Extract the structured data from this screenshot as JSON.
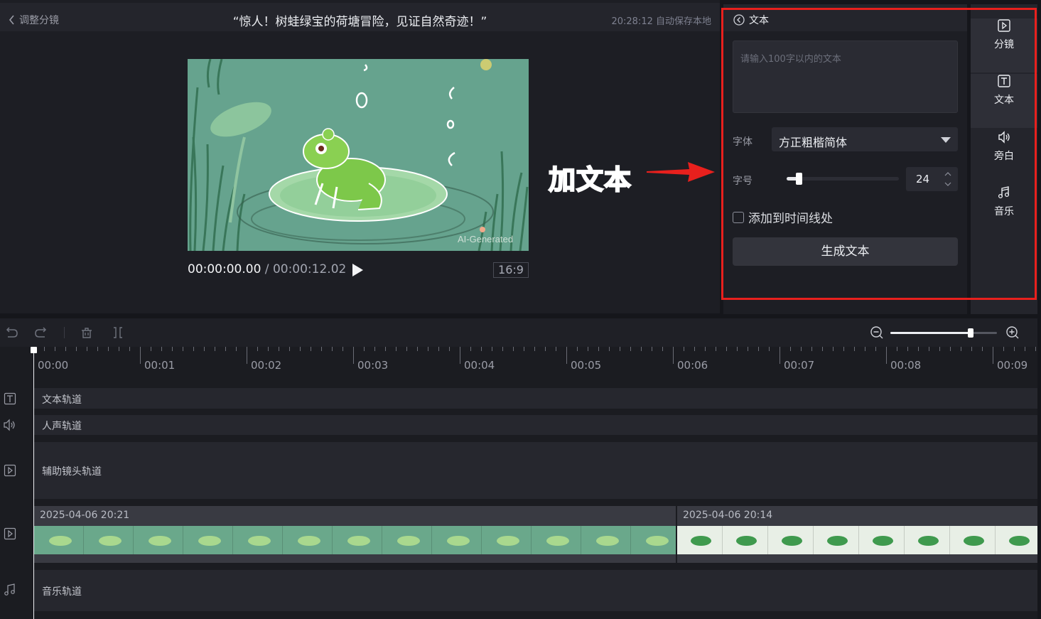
{
  "header": {
    "back_label": "调整分镜",
    "title": "“惊人！树蛙绿宝的荷塘冒险，见证自然奇迹！”",
    "autosave": "20:28:12 自动保存本地"
  },
  "player": {
    "current_time": "00:00:00.00",
    "separator": " / ",
    "total_time": "00:00:12.02",
    "aspect_ratio": "16:9",
    "watermark": "AI-Generated"
  },
  "annotation": {
    "text": "加文本",
    "color": "#e8201d"
  },
  "text_panel": {
    "back_label": "文本",
    "input_placeholder": "请输入100字以内的文本",
    "input_value": "",
    "font_label": "字体",
    "font_value": "方正粗楷简体",
    "size_label": "字号",
    "size_value": "24",
    "size_slider_fraction": 0.1,
    "add_to_timeline_label": "添加到时间线处",
    "add_to_timeline_checked": false,
    "generate_button": "生成文本"
  },
  "side_tabs": [
    {
      "label": "分镜",
      "icon": "storyboard-play-icon",
      "active": true
    },
    {
      "label": "文本",
      "icon": "text-t-icon",
      "active": true
    },
    {
      "label": "旁白",
      "icon": "speaker-icon",
      "active": false
    },
    {
      "label": "音乐",
      "icon": "music-note-icon",
      "active": false
    }
  ],
  "timeline": {
    "zoom_fraction": 0.75,
    "ticks": [
      "00:00",
      "00:01",
      "00:02",
      "00:03",
      "00:04",
      "00:05",
      "00:06",
      "00:07",
      "00:08",
      "00:09"
    ],
    "tracks": {
      "text": "文本轨道",
      "voice": "人声轨道",
      "aux": "辅助镜头轨道",
      "music": "音乐轨道"
    },
    "clips": [
      {
        "date": "2025-04-06 20:21"
      },
      {
        "date": "2025-04-06 20:14"
      }
    ]
  },
  "colors": {
    "accent_red": "#e8201d",
    "panel_bg": "#1d1e24",
    "clip1_tint": "#6aa88b",
    "clip2_tint": "#e8efe6"
  }
}
